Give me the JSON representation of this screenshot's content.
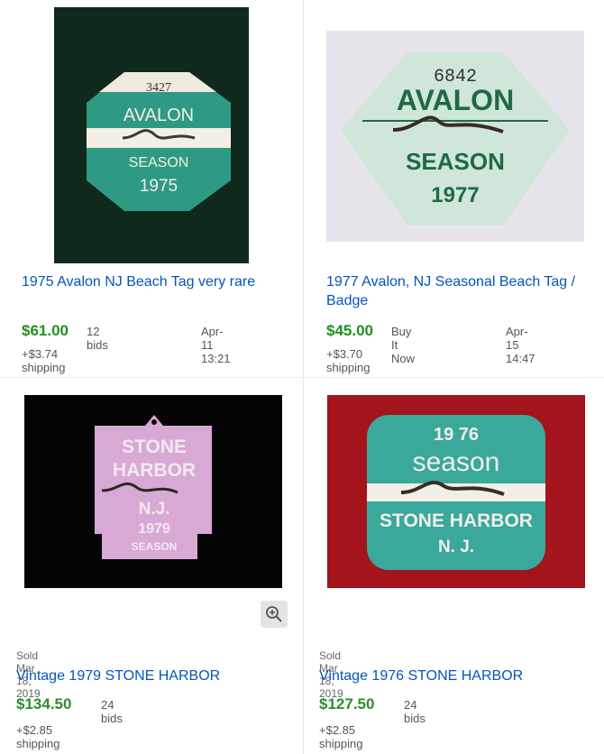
{
  "listings": [
    {
      "title": "1975 Avalon NJ Beach Tag very rare",
      "price": "$61.00",
      "bids": "12 bids",
      "end_time": "Apr-11 13:21",
      "shipping": "+$3.74 shipping",
      "tag": {
        "number": "3427",
        "town": "AVALON",
        "season": "SEASON",
        "year": "1975"
      }
    },
    {
      "title": "1977 Avalon, NJ Seasonal Beach Tag / Badge",
      "price": "$45.00",
      "format": "Buy It Now",
      "end_time": "Apr-15 14:47",
      "shipping": "+$3.70 shipping",
      "tag": {
        "number": "6842",
        "town": "AVALON",
        "season": "SEASON",
        "year": "1977"
      }
    },
    {
      "sold": "Sold Mar 18, 2019",
      "title": "Vintage 1979 STONE HARBOR",
      "price": "$134.50",
      "bids": "24 bids",
      "shipping": "+$2.85 shipping",
      "tag": {
        "line1": "STONE",
        "line2": "HARBOR",
        "line3": "N.J.",
        "year": "1979",
        "season": "SEASON"
      }
    },
    {
      "sold": "Sold Mar 18, 2019",
      "title": "Vintage 1976 STONE HARBOR",
      "price": "$127.50",
      "bids": "24 bids",
      "shipping": "+$2.85 shipping",
      "tag": {
        "year": "19 76",
        "season": "season",
        "town": "STONE HARBOR",
        "state": "N. J."
      }
    }
  ],
  "colors": {
    "link": "#0654ba",
    "price": "#1f8f1f"
  },
  "icons": {
    "zoom": "zoom-in-icon"
  }
}
